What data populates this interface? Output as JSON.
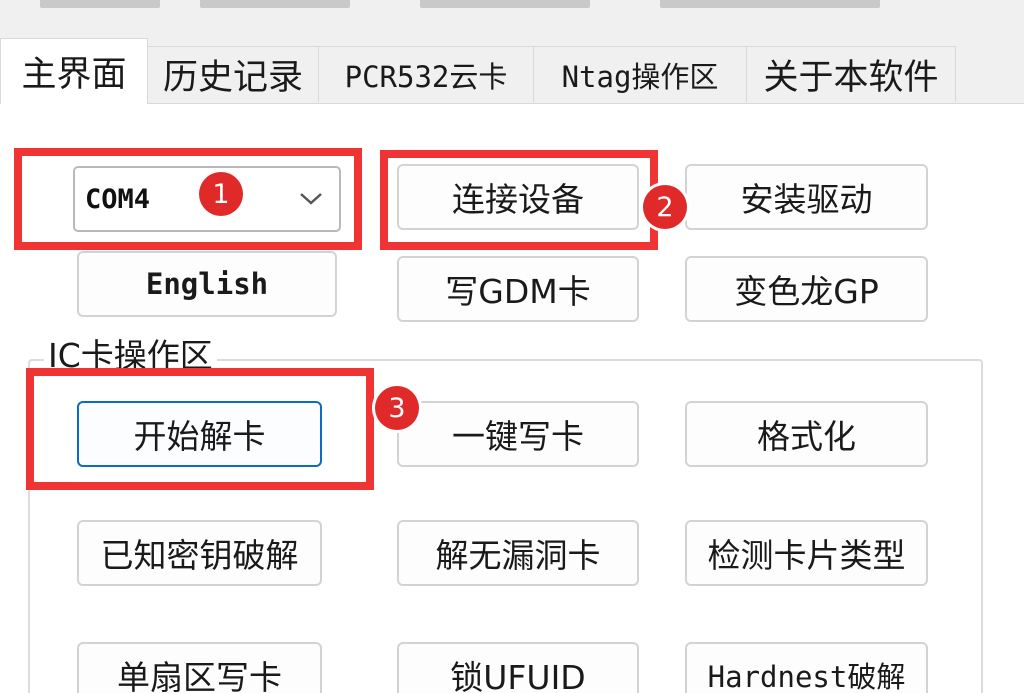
{
  "tabs": [
    {
      "label": "主界面",
      "active": true
    },
    {
      "label": "历史记录",
      "active": false
    },
    {
      "label": "PCR532云卡",
      "active": false
    },
    {
      "label": "Ntag操作区",
      "active": false
    },
    {
      "label": "关于本软件",
      "active": false
    }
  ],
  "port_combo": {
    "value": "COM4",
    "icon": "chevron-down-icon"
  },
  "buttons": {
    "connect": "连接设备",
    "install_driver": "安装驱动",
    "english": "English",
    "write_gdm": "写GDM卡",
    "chameleon_gp": "变色龙GP"
  },
  "ic_group": {
    "title": "IC卡操作区",
    "buttons": {
      "start_crack": "开始解卡",
      "one_key_write": "一键写卡",
      "format": "格式化",
      "known_key_crack": "已知密钥破解",
      "no_vuln_crack": "解无漏洞卡",
      "detect_card_type": "检测卡片类型",
      "single_sector_write": "单扇区写卡",
      "lock_ufuid": "锁UFUID",
      "hardnest_crack": "Hardnest破解"
    }
  },
  "annotations": {
    "badge_1": "1",
    "badge_2": "2",
    "badge_3": "3",
    "highlight_color": "#f03434",
    "badge_color": "#e02a2a"
  }
}
